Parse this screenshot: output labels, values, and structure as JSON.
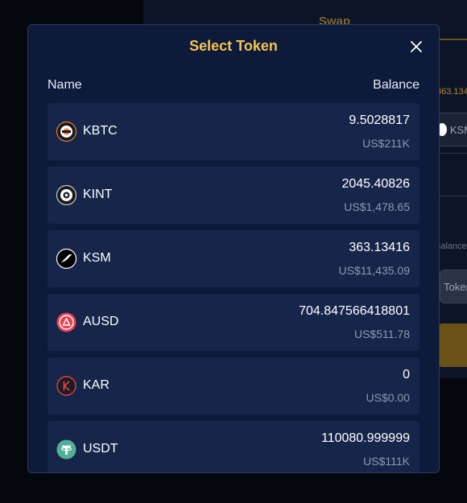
{
  "background": {
    "tab_label": "Swap",
    "top_balance": "363.134",
    "token_chip_label": "KSM",
    "balance_label": "Balance",
    "token_select_label": "Token"
  },
  "modal": {
    "title": "Select Token",
    "header": {
      "name": "Name",
      "balance": "Balance"
    },
    "tokens": [
      {
        "symbol": "KBTC",
        "balance": "9.5028817",
        "value": "US$211K",
        "icon": "kbtc-icon"
      },
      {
        "symbol": "KINT",
        "balance": "2045.40826",
        "value": "US$1,478.65",
        "icon": "kint-icon"
      },
      {
        "symbol": "KSM",
        "balance": "363.13416",
        "value": "US$11,435.09",
        "icon": "ksm-icon"
      },
      {
        "symbol": "AUSD",
        "balance": "704.847566418801",
        "value": "US$511.78",
        "icon": "ausd-icon"
      },
      {
        "symbol": "KAR",
        "balance": "0",
        "value": "US$0.00",
        "icon": "kar-icon"
      },
      {
        "symbol": "USDT",
        "balance": "110080.999999",
        "value": "US$111K",
        "icon": "usdt-icon"
      }
    ]
  },
  "colors": {
    "accent": "#f5c44e",
    "modal_bg": "#0e1a3a",
    "row_bg": "#16254a",
    "muted_text": "#8e98ad"
  }
}
